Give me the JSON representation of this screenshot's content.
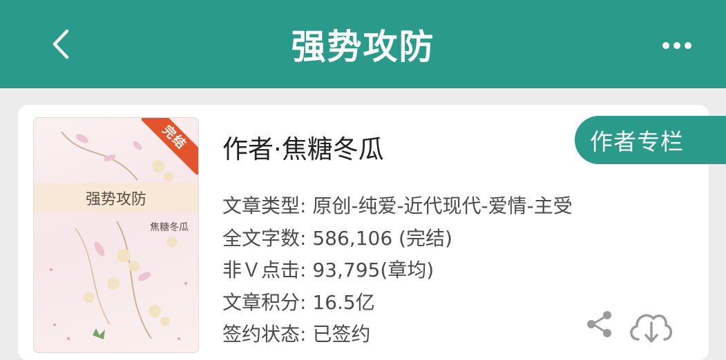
{
  "header": {
    "title": "强势攻防",
    "back_icon": "chevron-left-icon",
    "more_icon": "ellipsis-icon",
    "bg_color": "#2a9a8b"
  },
  "book": {
    "cover": {
      "title": "强势攻防",
      "author": "焦糖冬瓜",
      "ribbon": "完结",
      "ribbon_color": "#e2542b"
    },
    "author_line": "作者·焦糖冬瓜",
    "author_column_label": "作者专栏",
    "info": [
      {
        "label": "文章类型:",
        "value": "原创-纯爱-近代现代-爱情-主受"
      },
      {
        "label": "全文字数:",
        "value": "586,106 (完结)"
      },
      {
        "label": "非Ｖ点击:",
        "value": "93,795(章均)"
      },
      {
        "label": "文章积分:",
        "value": "16.5亿"
      },
      {
        "label": "签约状态:",
        "value": "已签约"
      }
    ],
    "actions": {
      "share_icon": "share-icon",
      "download_icon": "cloud-download-icon"
    }
  }
}
